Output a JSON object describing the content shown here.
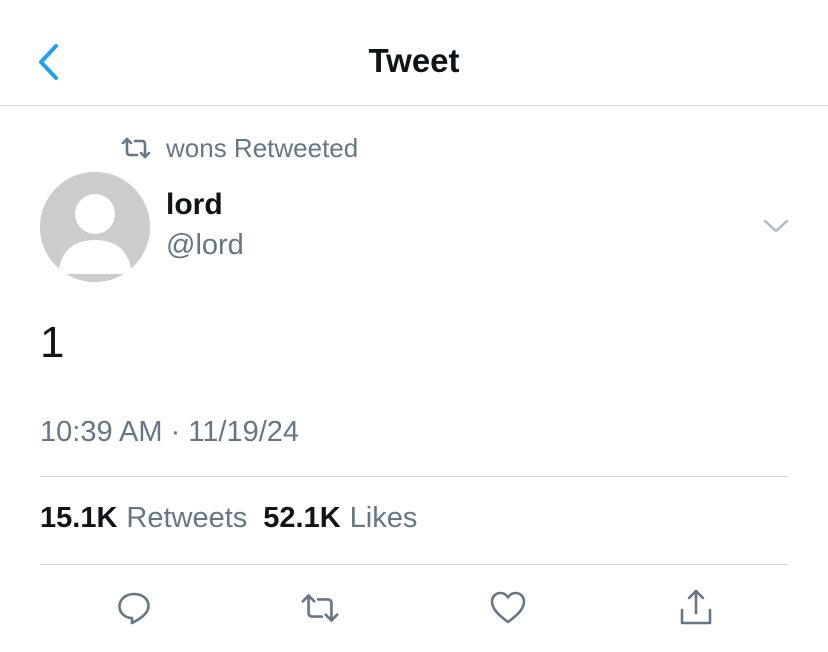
{
  "header": {
    "title": "Tweet",
    "back_icon": "chevron-left-icon",
    "accent": "#1da1f2"
  },
  "retweet_context": {
    "icon": "retweet-icon",
    "text": "wons Retweeted"
  },
  "author": {
    "avatar_icon": "default-avatar-icon",
    "name": "lord",
    "handle": "@lord",
    "menu_icon": "chevron-down-icon"
  },
  "tweet": {
    "text": "1",
    "timestamp": "10:39 AM · 11/19/24"
  },
  "stats": {
    "retweets_count": "15.1K",
    "retweets_label": "Retweets",
    "likes_count": "52.1K",
    "likes_label": "Likes"
  },
  "actions": [
    "reply-icon",
    "retweet-icon",
    "like-icon",
    "share-icon"
  ],
  "colors": {
    "text": "#0f1419",
    "secondary": "#657786",
    "divider": "#d6d9dc",
    "avatar_bg": "#cccccc"
  }
}
